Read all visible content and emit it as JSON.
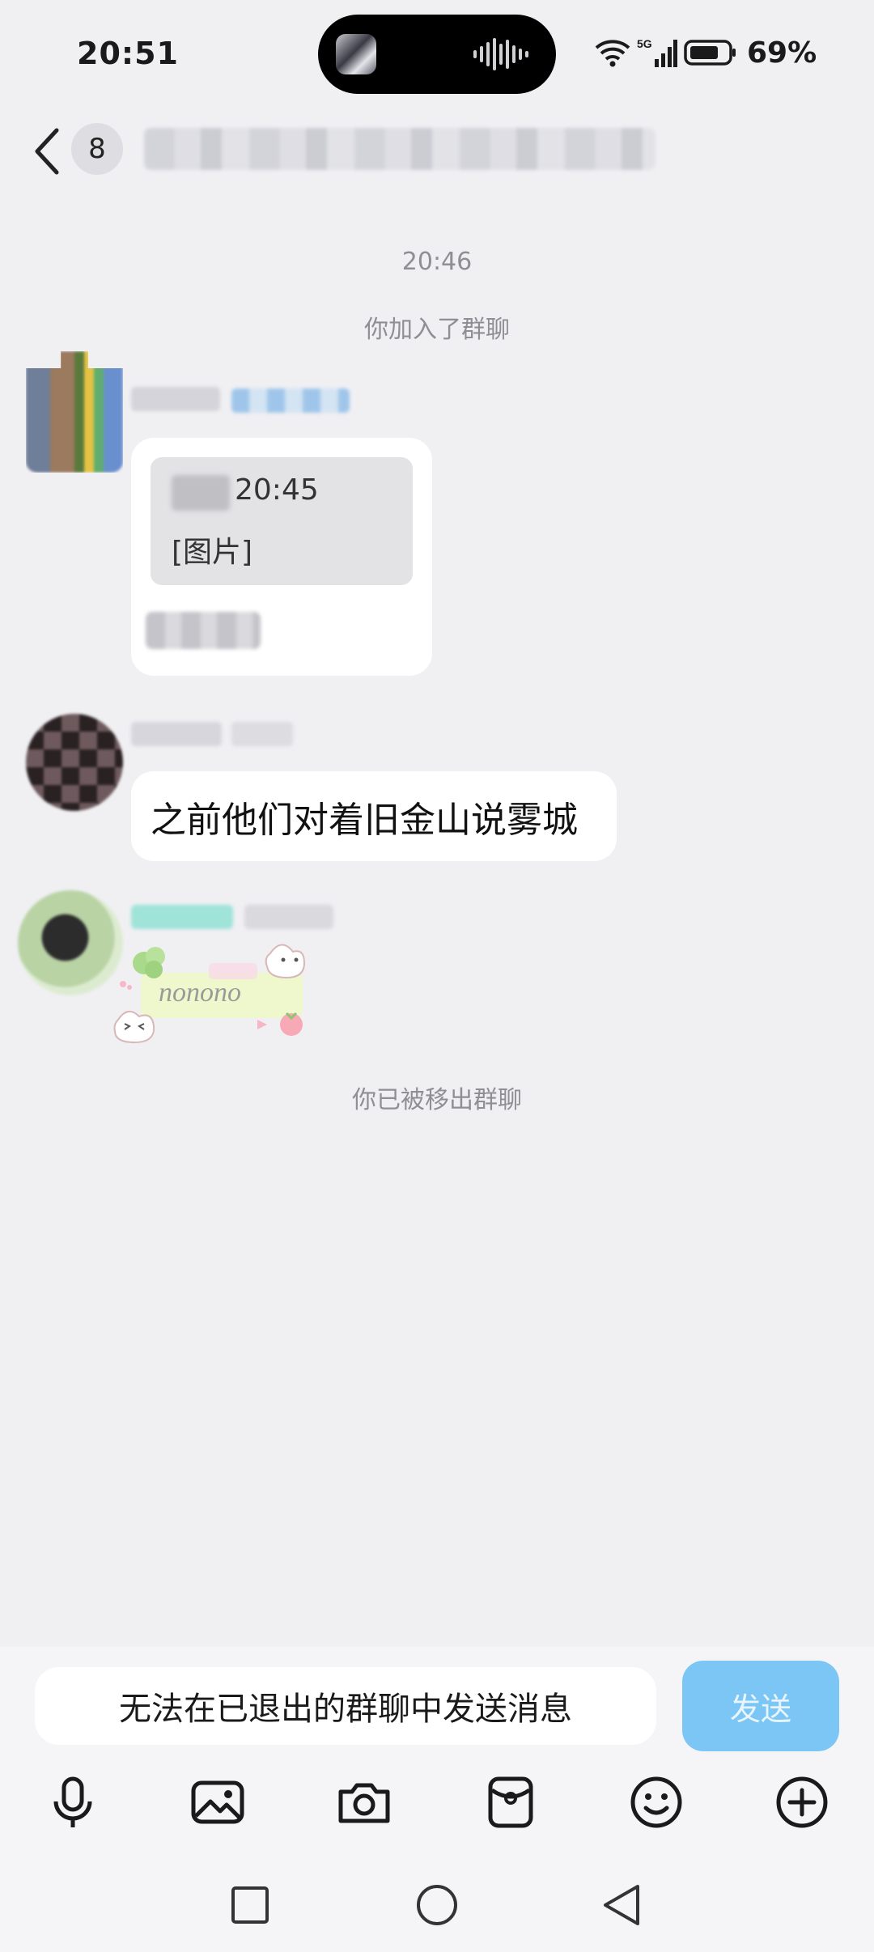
{
  "status_bar": {
    "time": "20:51",
    "battery": "69%",
    "network": "5G"
  },
  "header": {
    "member_count": "8",
    "title": ""
  },
  "chat": {
    "timestamp": "20:46",
    "join_notice": "你加入了群聊",
    "forward_card": {
      "time": "20:45",
      "label": "[图片]"
    },
    "message_text": "之前他们对着旧金山说雾城",
    "sticker_text": "nonono",
    "removed_notice": "你已被移出群聊"
  },
  "composer": {
    "placeholder": "无法在已退出的群聊中发送消息",
    "send_label": "发送"
  },
  "toolbar": [
    "mic-icon",
    "image-icon",
    "camera-icon",
    "red-packet-icon",
    "emoji-icon",
    "plus-icon"
  ],
  "nav": [
    "recents-square-icon",
    "home-circle-icon",
    "back-triangle-icon"
  ],
  "colors": {
    "background": "#f0f0f3",
    "send_button": "#7cc6f5",
    "bubble": "#ffffff",
    "system_text": "#8e8e94"
  }
}
